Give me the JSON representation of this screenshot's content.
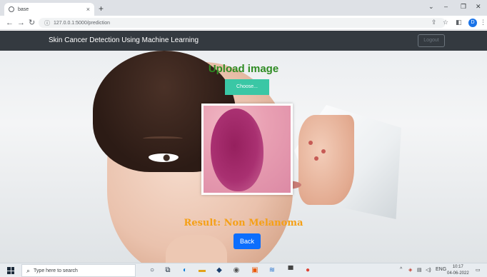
{
  "browser": {
    "tab_title": "base",
    "tab_close": "×",
    "new_tab": "+",
    "url": "127.0.0.1:5000/prediction",
    "win_minimize": "–",
    "win_restore": "❐",
    "win_close": "✕",
    "tab_search": "⌄",
    "profile_initial": "D"
  },
  "navbar": {
    "brand": "Skin Cancer Detection Using Machine Learning",
    "logout_label": "Logout"
  },
  "main": {
    "upload_title": "Upload image",
    "choose_label": "Choose...",
    "result_text": "Result: Non Melanoma",
    "back_label": "Back"
  },
  "taskbar": {
    "search_placeholder": "Type here to search",
    "language": "ENG",
    "time": "10:17",
    "date": "04-06-2022"
  },
  "colors": {
    "upload_title": "#2e8b22",
    "choose_button": "#3ac7a5",
    "result_text": "#f5a016",
    "back_button": "#0d6efd",
    "navbar": "#343a40"
  }
}
